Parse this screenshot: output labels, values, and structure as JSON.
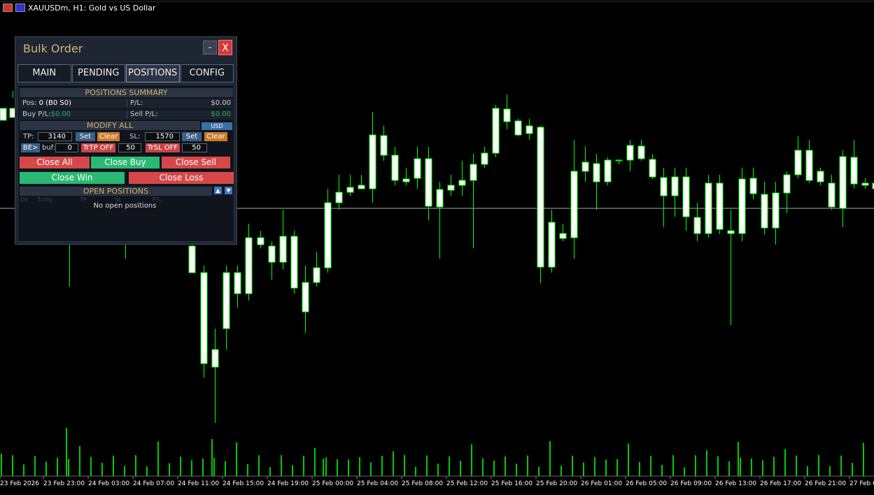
{
  "window": {
    "title": "XAUUSDm, H1:  Gold vs US Dollar"
  },
  "panel": {
    "title": "Bulk Order",
    "minimize_label": "-",
    "close_label": "X",
    "tabs": [
      {
        "label": "MAIN",
        "active": false
      },
      {
        "label": "PENDING",
        "active": false
      },
      {
        "label": "POSITIONS",
        "active": true
      },
      {
        "label": "CONFIG",
        "active": false
      }
    ],
    "summary": {
      "header": "POSITIONS SUMMARY",
      "pos_label": "Pos:",
      "pos_value": "0 (B0 S0)",
      "pl_label": "P/L:",
      "pl_value": "$0.00",
      "buy_pl_label": "Buy P/L:",
      "buy_pl_value": "$0.00",
      "sell_pl_label": "Sell P/L:",
      "sell_pl_value": "$0.00"
    },
    "modify": {
      "header": "MODIFY ALL",
      "usd_label": "USD",
      "tp_label": "TP:",
      "tp_value": "3140",
      "sl_label": "SL:",
      "sl_value": "1570",
      "set_label": "Set",
      "clear_label": "Clear",
      "be_label": "BE>",
      "buf_label": "buf:",
      "buf_value": "0",
      "trtp_label": "TrTP OFF",
      "trtp_value": "50",
      "trsl_label": "TrSL OFF",
      "trsl_value": "50"
    },
    "actions": {
      "close_all": "Close All",
      "close_buy": "Close Buy",
      "close_sell": "Close Sell",
      "close_win": "Close Win",
      "close_loss": "Close Loss"
    },
    "open_positions": {
      "header": "OPEN POSITIONS",
      "up_label": "▲",
      "down_label": "▼",
      "columns": [
        "Dir",
        "Entry",
        "TP",
        "SL",
        "P/L"
      ],
      "empty_text": "No open positions"
    }
  },
  "chart_data": {
    "type": "candlestick",
    "x_labels": [
      "23 Feb 2026",
      "23 Feb 23:00",
      "24 Feb 03:00",
      "24 Feb 07:00",
      "24 Feb 11:00",
      "24 Feb 15:00",
      "24 Feb 19:00",
      "25 Feb 00:00",
      "25 Feb 04:00",
      "25 Feb 08:00",
      "25 Feb 12:00",
      "25 Feb 16:00",
      "25 Feb 20:00",
      "26 Feb 01:00",
      "26 Feb 05:00",
      "26 Feb 09:00",
      "26 Feb 13:00",
      "26 Feb 17:00",
      "26 Feb 21:00",
      "27 Feb 0"
    ],
    "grid": false,
    "colors": {
      "background": "#000000",
      "up": "#00ff00",
      "down": "#ffffff",
      "line": "#aaaaaa",
      "volume": "#00cc00"
    }
  }
}
